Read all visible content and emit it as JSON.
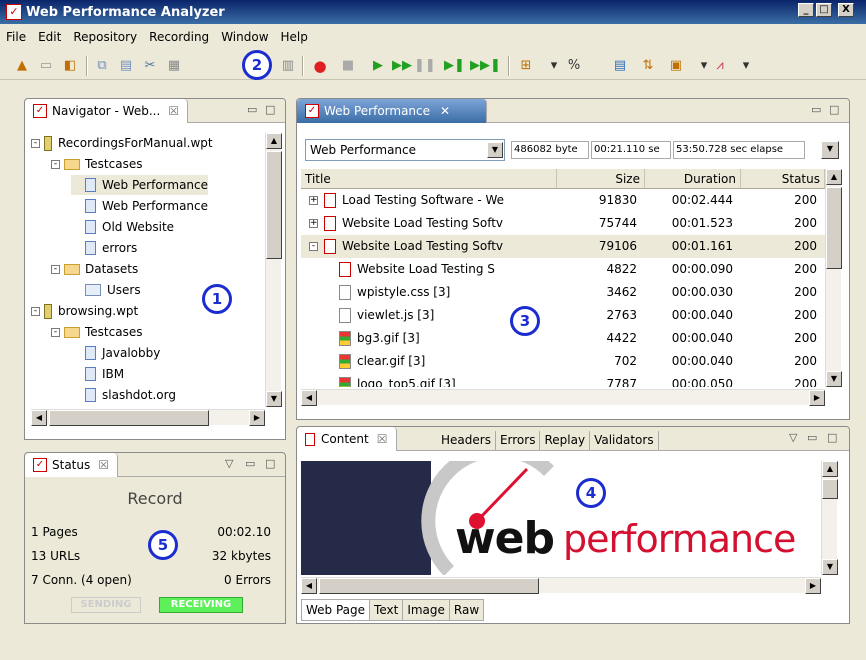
{
  "window": {
    "title": "Web Performance Analyzer",
    "min_label": "_",
    "max_label": "□",
    "close_label": "X"
  },
  "menu": [
    "File",
    "Edit",
    "Repository",
    "Recording",
    "Window",
    "Help"
  ],
  "toolbar_icons": [
    "new-icon",
    "open-icon",
    "save-icon",
    "copy-icon",
    "paste-icon",
    "cut-icon",
    "export-icon",
    "record-icon",
    "stop-icon",
    "play-icon",
    "fast-forward-icon",
    "pause-icon",
    "step-icon",
    "skip-icon",
    "compare-icon",
    "percent-icon",
    "analyze-icon",
    "sort-icon",
    "report-icon",
    "chart-icon"
  ],
  "navigator": {
    "tab_label": "Navigator - Web...",
    "tree": [
      {
        "label": "RecordingsForManual.wpt",
        "kind": "project",
        "indent": 0,
        "expander": "-"
      },
      {
        "label": "Testcases",
        "kind": "folder",
        "indent": 1,
        "expander": "-"
      },
      {
        "label": "Web Performance",
        "kind": "file",
        "indent": 2,
        "selected": true
      },
      {
        "label": "Web Performance",
        "kind": "file",
        "indent": 2
      },
      {
        "label": "Old Website",
        "kind": "file",
        "indent": 2
      },
      {
        "label": "errors",
        "kind": "file",
        "indent": 2
      },
      {
        "label": "Datasets",
        "kind": "folder",
        "indent": 1,
        "expander": "-"
      },
      {
        "label": "Users",
        "kind": "dataset",
        "indent": 2
      },
      {
        "label": "browsing.wpt",
        "kind": "project",
        "indent": 0,
        "expander": "-"
      },
      {
        "label": "Testcases",
        "kind": "folder",
        "indent": 1,
        "expander": "-"
      },
      {
        "label": "Javalobby",
        "kind": "file",
        "indent": 2
      },
      {
        "label": "IBM",
        "kind": "file",
        "indent": 2
      },
      {
        "label": "slashdot.org",
        "kind": "file",
        "indent": 2
      }
    ]
  },
  "editor": {
    "tab_label": "Web Performance",
    "tab_close": "✕",
    "combo_value": "Web Performance",
    "stat_bytes": "486082 byte",
    "stat_duration": "00:21.110 se",
    "stat_elapsed": "53:50.728 sec elapse",
    "columns": [
      "Title",
      "Size",
      "Duration",
      "Status"
    ],
    "rows": [
      {
        "title": "Load Testing Software - We",
        "size": "91830",
        "duration": "00:02.444",
        "status": "200",
        "expander": "+",
        "icon": "page",
        "indent": 0
      },
      {
        "title": "Website Load Testing Softv",
        "size": "75744",
        "duration": "00:01.523",
        "status": "200",
        "expander": "+",
        "icon": "page",
        "indent": 0
      },
      {
        "title": "Website Load Testing Softv",
        "size": "79106",
        "duration": "00:01.161",
        "status": "200",
        "expander": "-",
        "icon": "page",
        "indent": 0,
        "selected": true
      },
      {
        "title": "Website Load Testing S",
        "size": "4822",
        "duration": "00:00.090",
        "status": "200",
        "icon": "page",
        "indent": 1
      },
      {
        "title": "wpistyle.css [3]",
        "size": "3462",
        "duration": "00:00.030",
        "status": "200",
        "icon": "text",
        "indent": 1
      },
      {
        "title": "viewlet.js [3]",
        "size": "2763",
        "duration": "00:00.040",
        "status": "200",
        "icon": "text",
        "indent": 1
      },
      {
        "title": "bg3.gif [3]",
        "size": "4422",
        "duration": "00:00.040",
        "status": "200",
        "icon": "image",
        "indent": 1
      },
      {
        "title": "clear.gif [3]",
        "size": "702",
        "duration": "00:00.040",
        "status": "200",
        "icon": "image",
        "indent": 1
      },
      {
        "title": "logo_top5.gif [3]",
        "size": "7787",
        "duration": "00:00.050",
        "status": "200",
        "icon": "image",
        "indent": 1
      }
    ]
  },
  "content": {
    "tab_label": "Content",
    "tabs": [
      "Headers",
      "Errors",
      "Replay",
      "Validators"
    ],
    "bottom_tabs": [
      "Web Page",
      "Text",
      "Image",
      "Raw"
    ],
    "logo_web": "web",
    "logo_perf": "performance"
  },
  "status": {
    "tab_label": "Status",
    "title": "Record",
    "pages": "1 Pages",
    "time": "00:02.10",
    "urls": "13 URLs",
    "kbytes": "32 kbytes",
    "conn": "7 Conn. (4 open)",
    "errors": "0 Errors",
    "sending": "SENDING",
    "receiving": "RECEIVING"
  },
  "callouts": [
    "1",
    "2",
    "3",
    "4",
    "5"
  ],
  "colors": {
    "callout": "#1b2cd0",
    "receiving": "#5ef05a",
    "record_red": "#e02020",
    "play_green": "#22a022"
  }
}
